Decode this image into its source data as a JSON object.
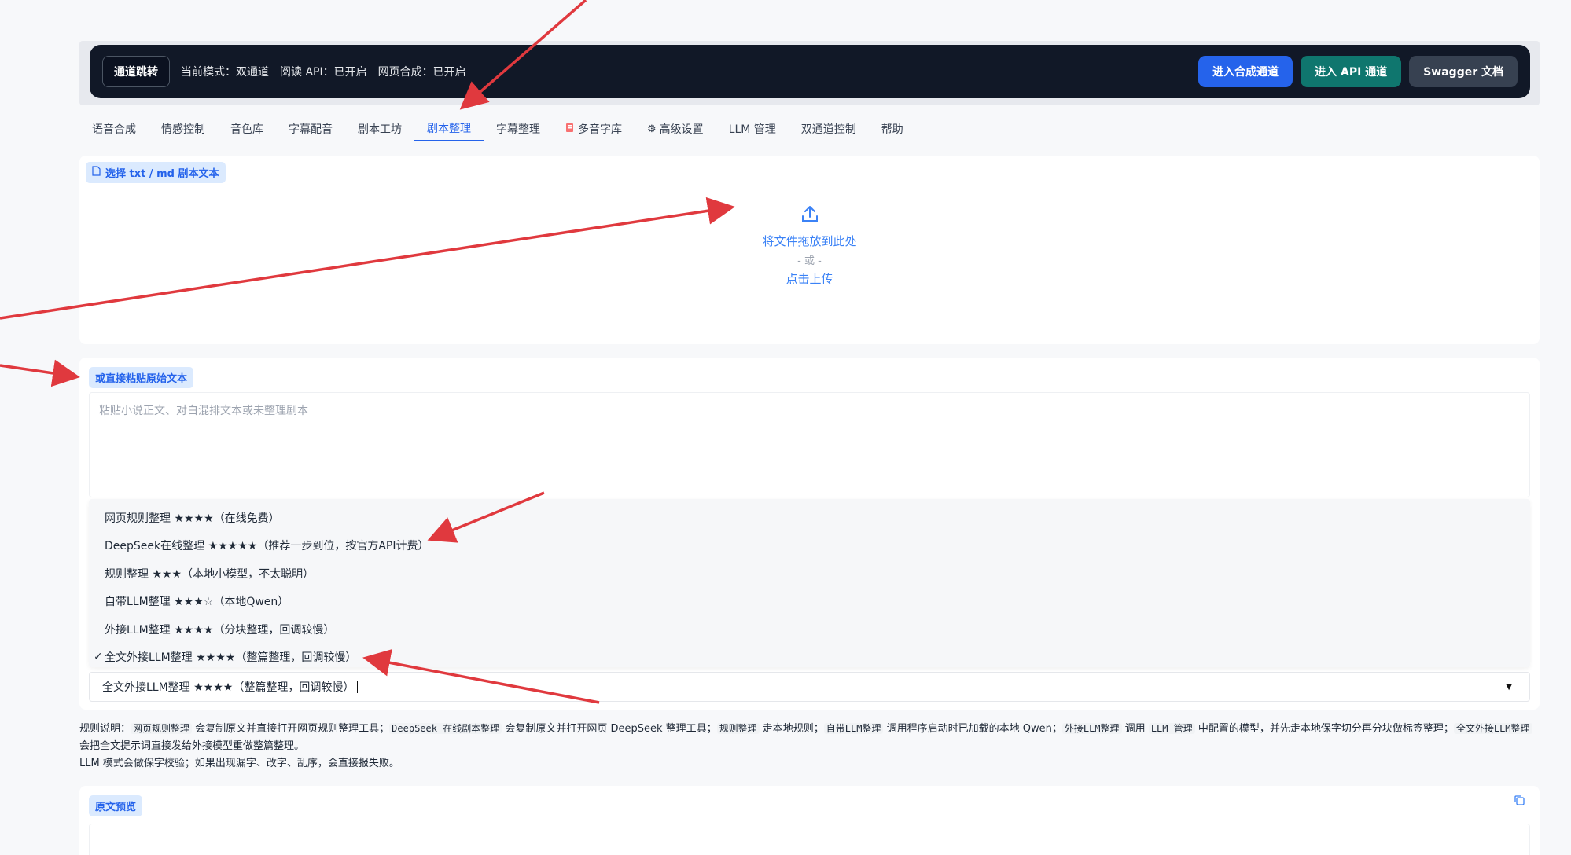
{
  "topbar": {
    "jump_label": "通道跳转",
    "mode": "当前模式：双通道",
    "read_api": "阅读 API：已开启",
    "web_synth": "网页合成：已开启",
    "btn_synth": "进入合成通道",
    "btn_api": "进入 API 通道",
    "btn_swagger": "Swagger 文档",
    "colors": {
      "bg": "#111827",
      "blue": "#2563eb",
      "green": "#0f766e",
      "gray": "#374151"
    }
  },
  "tabs": [
    {
      "label": "语音合成",
      "icon": ""
    },
    {
      "label": "情感控制",
      "icon": ""
    },
    {
      "label": "音色库",
      "icon": ""
    },
    {
      "label": "字幕配音",
      "icon": ""
    },
    {
      "label": "剧本工坊",
      "icon": ""
    },
    {
      "label": "剧本整理",
      "icon": "",
      "active": true
    },
    {
      "label": "字幕整理",
      "icon": ""
    },
    {
      "label": "多音字库",
      "icon": "book-icon"
    },
    {
      "label": "高级设置",
      "icon": "gear-icon"
    },
    {
      "label": "LLM 管理",
      "icon": ""
    },
    {
      "label": "双通道控制",
      "icon": ""
    },
    {
      "label": "帮助",
      "icon": ""
    }
  ],
  "upload": {
    "label": "选择 txt / md 剧本文本",
    "drop_text": "将文件拖放到此处",
    "or_text": "- 或 -",
    "click_text": "点击上传"
  },
  "paste": {
    "label": "或直接粘贴原始文本",
    "placeholder": "粘贴小说正文、对白混排文本或未整理剧本",
    "options": [
      "网页规则整理 ★★★★（在线免费）",
      "DeepSeek在线整理 ★★★★★（推荐一步到位，按官方API计费）",
      "规则整理 ★★★（本地小模型，不太聪明）",
      "自带LLM整理 ★★★☆（本地Qwen）",
      "外接LLM整理 ★★★★（分块整理，回调较慢）",
      "全文外接LLM整理 ★★★★（整篇整理，回调较慢）"
    ],
    "selected_index": 5,
    "check_mark": "✓",
    "selected_value": "全文外接LLM整理 ★★★★（整篇整理，回调较慢）"
  },
  "notes": {
    "prefix": "规则说明：",
    "c1": "网页规则整理",
    "t1": " 会复制原文并直接打开网页规则整理工具；",
    "c2": "DeepSeek 在线剧本整理",
    "t2": " 会复制原文并打开网页 DeepSeek 整理工具；",
    "c3": "规则整理",
    "t3": " 走本地规则；",
    "c4": "自带LLM整理",
    "t4": " 调用程序启动时已加载的本地 Qwen；",
    "c5": "外接LLM整理",
    "t5": " 调用 ",
    "c6": "LLM 管理",
    "t6": " 中配置的模型，并先走本地保字切分再分块做标签整理；",
    "c7": "全文外接LLM整理",
    "t7": " 会把全文提示词直接发给外接模型重做整篇整理。",
    "line2": "LLM 模式会做保字校验；如果出现漏字、改字、乱序，会直接报失败。"
  },
  "preview": {
    "label": "原文预览"
  }
}
